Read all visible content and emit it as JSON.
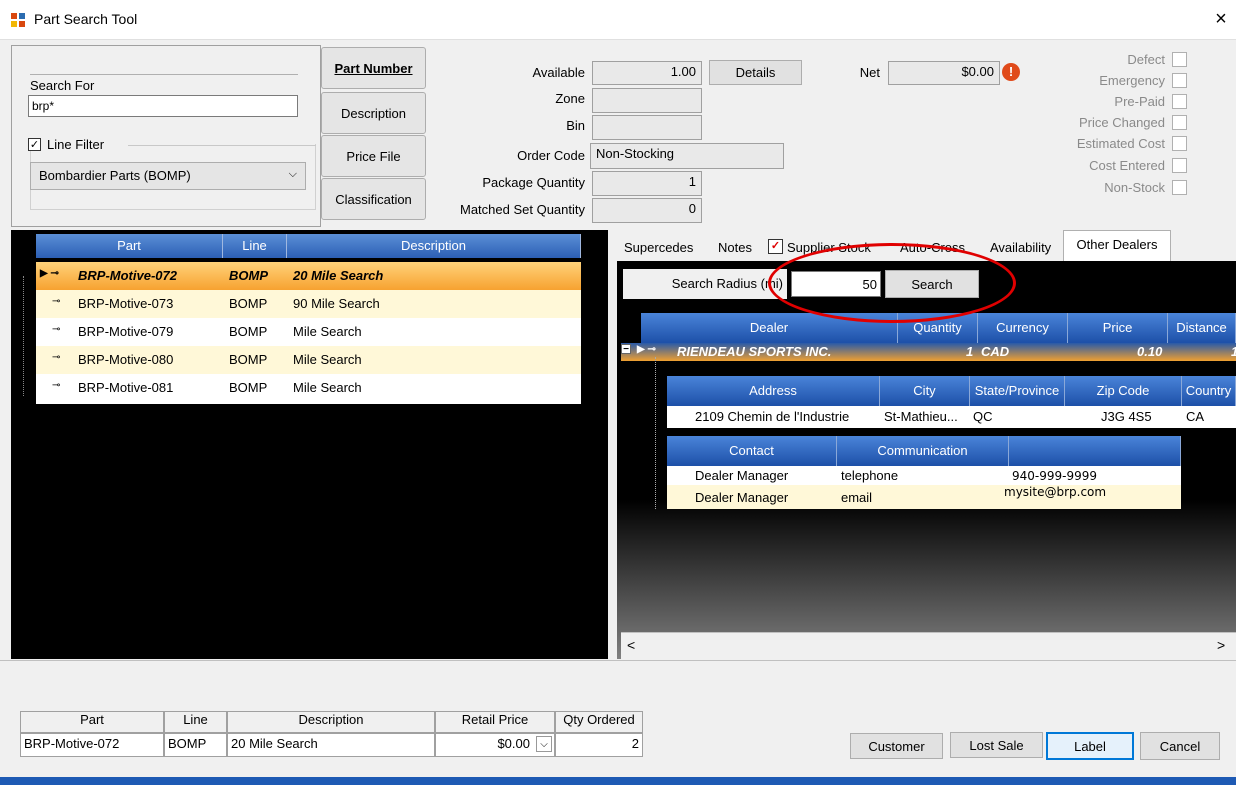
{
  "window": {
    "title": "Part Search Tool",
    "close_glyph": "×"
  },
  "search": {
    "group_label": "Search For",
    "value": "brp*",
    "line_filter_label": "Line Filter",
    "line_filter_checked": "✓",
    "line_filter_value": "Bombardier Parts (BOMP)",
    "buttons": {
      "part_number": "Part Number",
      "description": "Description",
      "price_file": "Price File",
      "classification": "Classification"
    }
  },
  "info": {
    "available_label": "Available",
    "available": "1.00",
    "details_button": "Details",
    "net_label": "Net",
    "net": "$0.00",
    "zone_label": "Zone",
    "zone": "",
    "bin_label": "Bin",
    "bin": "",
    "order_code_label": "Order Code",
    "order_code": "Non-Stocking",
    "package_qty_label": "Package Quantity",
    "package_qty": "1",
    "matched_set_label": "Matched Set Quantity",
    "matched_set": "0"
  },
  "flags": [
    "Defect",
    "Emergency",
    "Pre-Paid",
    "Price Changed",
    "Estimated Cost",
    "Cost Entered",
    "Non-Stock"
  ],
  "parts_grid": {
    "headers": [
      "Part",
      "Line",
      "Description"
    ],
    "rows": [
      {
        "part": "BRP-Motive-072",
        "line": "BOMP",
        "desc": "20 Mile Search"
      },
      {
        "part": "BRP-Motive-073",
        "line": "BOMP",
        "desc": "90 Mile Search"
      },
      {
        "part": "BRP-Motive-079",
        "line": "BOMP",
        "desc": "Mile Search"
      },
      {
        "part": "BRP-Motive-080",
        "line": "BOMP",
        "desc": "Mile Search"
      },
      {
        "part": "BRP-Motive-081",
        "line": "BOMP",
        "desc": "Mile Search"
      }
    ]
  },
  "tabs": {
    "supercedes": "Supercedes",
    "notes": "Notes",
    "supplier_stock": "Supplier Stock",
    "auto_cross": "Auto-Cross",
    "availability": "Availability",
    "other_dealers": "Other Dealers",
    "supplier_checked": "✓"
  },
  "dealers": {
    "radius_label": "Search Radius (mi)",
    "radius_value": "50",
    "search_button": "Search",
    "headers": [
      "Dealer",
      "Quantity",
      "Currency",
      "Price",
      "Distance"
    ],
    "row": {
      "dealer": "RIENDEAU SPORTS INC.",
      "quantity": "1",
      "currency": "CAD",
      "price": "0.10",
      "distance": "1"
    },
    "address_headers": [
      "Address",
      "City",
      "State/Province",
      "Zip Code",
      "Country"
    ],
    "address": {
      "address": "2109 Chemin de l'Industrie",
      "city": "St-Mathieu...",
      "state": "QC",
      "zip": "J3G 4S5",
      "country": "CA"
    },
    "contact_headers": [
      "Contact",
      "Communication",
      ""
    ],
    "contacts": [
      {
        "contact": "Dealer Manager",
        "comm": "telephone",
        "value": "940-999-9999"
      },
      {
        "contact": "Dealer Manager",
        "comm": "email",
        "value": "mysite@brp.com"
      }
    ]
  },
  "order": {
    "headers": [
      "Part",
      "Line",
      "Description",
      "Retail Price",
      "Qty Ordered"
    ],
    "part": "BRP-Motive-072",
    "line": "BOMP",
    "desc": "20 Mile Search",
    "price": "$0.00",
    "qty": "2"
  },
  "actions": {
    "customer": "Customer",
    "lost_sale": "Lost Sale",
    "label": "Label",
    "cancel": "Cancel"
  }
}
